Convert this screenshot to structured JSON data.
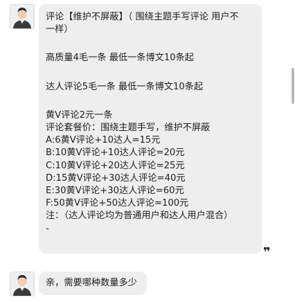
{
  "messages": [
    {
      "lines": [
        "评论【维护不屏蔽】（ 围绕主题手写评论 用户不",
        "一样）",
        "",
        "高质量4毛一条 最低一条博文10条起",
        "",
        "达人评论5毛一条 最低一条博文10条起",
        "",
        "黄V评论2元一条",
        "评论套餐价：围绕主题手写，维护不屏蔽",
        "A:6黄V评论+10达人=15元",
        "B:10黄V评论+10达人评论=20元",
        "C:10黄V评论+20达人评论=25元",
        "D:15黄V评论+30达人评论=40元",
        "E:30黄V评论+30达人评论=60元",
        "F:50黄V评论+50达人评论=100元",
        "注：（达人评论均为普通用户和达人用户混合）",
        "-"
      ]
    },
    {
      "text": "亲，需要哪种数量多少"
    }
  ],
  "quote_glyph": "❞",
  "icons": {
    "avatar": "user-avatar-icon",
    "quote": "quote-icon"
  },
  "colors": {
    "bubble": "#eeeeee",
    "background": "#ffffff",
    "text": "#1f1f1f"
  }
}
